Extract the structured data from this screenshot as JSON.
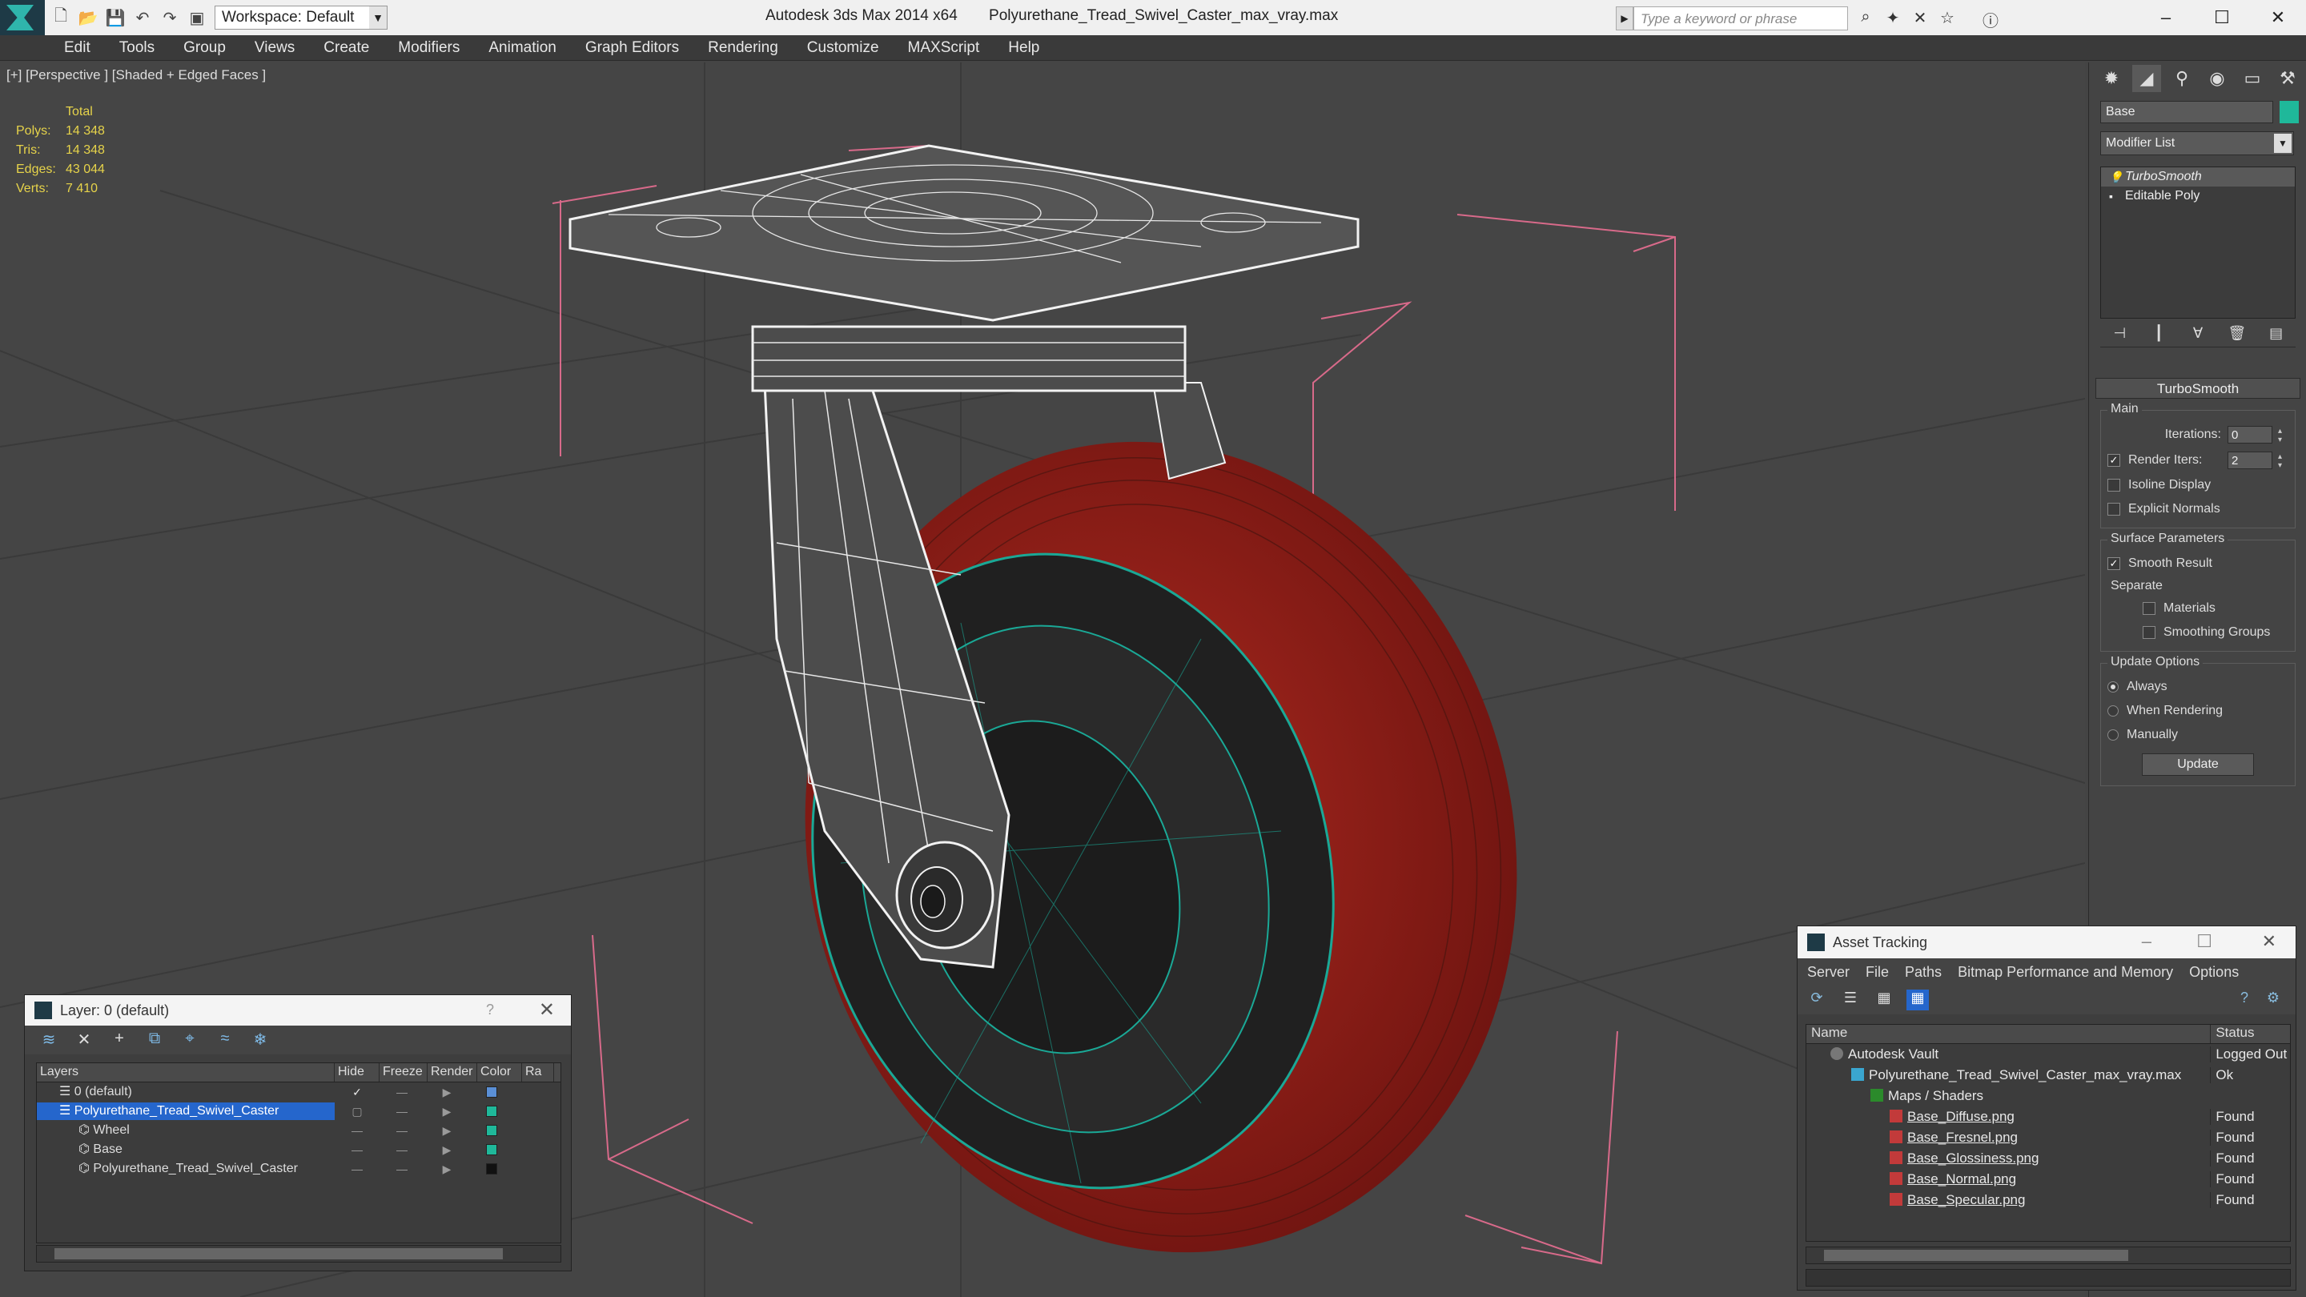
{
  "titlebar": {
    "workspace": "Workspace: Default",
    "app_name": "Autodesk 3ds Max 2014 x64",
    "file_name": "Polyurethane_Tread_Swivel_Caster_max_vray.max",
    "search_placeholder": "Type a keyword or phrase"
  },
  "menu": [
    "Edit",
    "Tools",
    "Group",
    "Views",
    "Create",
    "Modifiers",
    "Animation",
    "Graph Editors",
    "Rendering",
    "Customize",
    "MAXScript",
    "Help"
  ],
  "viewport": {
    "label": "[+] [Perspective ] [Shaded + Edged Faces ]",
    "stats": {
      "total_label": "Total",
      "rows": [
        {
          "k": "Polys:",
          "v": "14 348"
        },
        {
          "k": "Tris:",
          "v": "14 348"
        },
        {
          "k": "Edges:",
          "v": "43 044"
        },
        {
          "k": "Verts:",
          "v": "7 410"
        }
      ]
    }
  },
  "command_panel": {
    "object_name": "Base",
    "object_color": "#1fb89a",
    "modifier_list": "Modifier List",
    "stack": [
      "TurboSmooth",
      "Editable Poly"
    ],
    "turbosmooth": {
      "title": "TurboSmooth",
      "main_label": "Main",
      "iterations_label": "Iterations:",
      "iterations": "0",
      "render_iters_label": "Render Iters:",
      "render_iters": "2",
      "isoline_display": "Isoline Display",
      "explicit_normals": "Explicit Normals",
      "surface_params_label": "Surface Parameters",
      "smooth_result": "Smooth Result",
      "separate_label": "Separate",
      "materials": "Materials",
      "smoothing_groups": "Smoothing Groups",
      "update_options_label": "Update Options",
      "always": "Always",
      "when_rendering": "When Rendering",
      "manually": "Manually",
      "update_button": "Update"
    }
  },
  "layer_dialog": {
    "title": "Layer: 0 (default)",
    "help": "?",
    "columns": [
      "Layers",
      "Hide",
      "Freeze",
      "Render",
      "Color",
      "Ra"
    ],
    "rows": [
      {
        "name": "0 (default)",
        "color": "#5a8fd6"
      },
      {
        "name": "Polyurethane_Tread_Swivel_Caster",
        "color": "#1fb89a"
      },
      {
        "name": "Wheel",
        "color": "#1fb89a"
      },
      {
        "name": "Base",
        "color": "#1fb89a"
      },
      {
        "name": "Polyurethane_Tread_Swivel_Caster",
        "color": "#111111"
      }
    ]
  },
  "asset_dialog": {
    "title": "Asset Tracking",
    "menu": [
      "Server",
      "File",
      "Paths",
      "Bitmap Performance and Memory",
      "Options"
    ],
    "columns": [
      "Name",
      "Status"
    ],
    "rows": [
      {
        "name": "Autodesk Vault",
        "status": "Logged Out"
      },
      {
        "name": "Polyurethane_Tread_Swivel_Caster_max_vray.max",
        "status": "Ok"
      },
      {
        "name": "Maps / Shaders",
        "status": ""
      },
      {
        "name": "Base_Diffuse.png",
        "status": "Found"
      },
      {
        "name": "Base_Fresnel.png",
        "status": "Found"
      },
      {
        "name": "Base_Glossiness.png",
        "status": "Found"
      },
      {
        "name": "Base_Normal.png",
        "status": "Found"
      },
      {
        "name": "Base_Specular.png",
        "status": "Found"
      }
    ]
  }
}
